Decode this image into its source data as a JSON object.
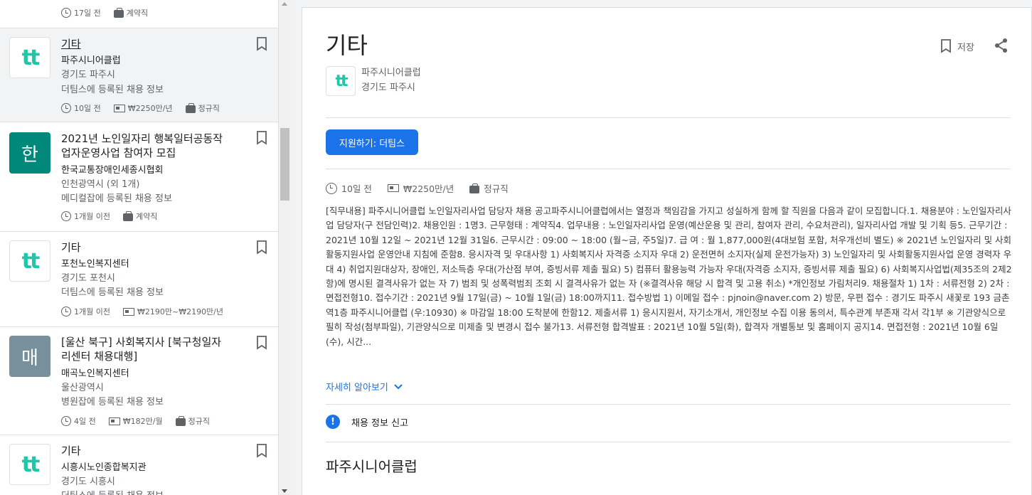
{
  "list": {
    "top_item": {
      "posted": "17일 전",
      "type": "계약직"
    },
    "items": [
      {
        "logo": "tt",
        "title": "기타",
        "company": "파주시니어클럽",
        "location": "경기도 파주시",
        "via": "더팀스에 등록된 채용 정보",
        "posted": "10일 전",
        "salary": "₩2250만/년",
        "type": "정규직"
      },
      {
        "logo": "한",
        "logo_color": "#00897b",
        "title": "2021년 노인일자리 행복일터공동작업자운영사업 참여자 모집",
        "title_line1": "2021년 노인일자리 행복일터공동작",
        "title_line2": "업자운영사업 참여자 모집",
        "company": "한국교통장애인세종시협회",
        "location": "인천광역시 (외 1개)",
        "via": "메디컬잡에 등록된 채용 정보",
        "posted": "1개월 이전",
        "type": "계약직"
      },
      {
        "logo": "tt",
        "title": "기타",
        "company": "포천노인복지센터",
        "location": "경기도 포천시",
        "via": "더팀스에 등록된 채용 정보",
        "posted": "1개월 이전",
        "salary": "₩2190만~₩2190만/년"
      },
      {
        "logo": "매",
        "logo_color": "#78909c",
        "title_line1": "[울산 북구] 사회복지사 [북구청일자",
        "title_line2": "리센터 채용대행]",
        "company": "매곡노인복지센터",
        "location": "울산광역시",
        "via": "병원잡에 등록된 채용 정보",
        "posted": "4일 전",
        "salary": "₩182만/월",
        "type": "정규직"
      },
      {
        "logo": "tt",
        "title": "기타",
        "company": "시흥시노인종합복지관",
        "location": "경기도 시흥시",
        "via": "더팀스에 등록된 채용 정보"
      }
    ]
  },
  "detail": {
    "title": "기타",
    "save_label": "저장",
    "company": "파주시니어클럽",
    "location": "경기도 파주시",
    "apply_label": "지원하기: 더팀스",
    "posted": "10일 전",
    "salary": "₩2250만/년",
    "type": "정규직",
    "description": "[직무내용] 파주시니어클럽 노인일자리사업 담당자 채용 공고파주시니어클럽에서는 열정과 책임감을 가지고 성실하게 함께 할 직원을 다음과 같이 모집합니다.1. 채용분야 : 노인일자리사업 담당자(구 전담인력)2. 채용인원 : 1명3. 근무형태 : 계약직4. 업무내용 : 노인일자리사업 운영(예산운용 및 관리, 참여자 관리, 수요처관리), 일자리사업 개발 및 기획 등5. 근무기간 : 2021년 10월 12일 ~ 2021년 12월 31일6. 근무시간 : 09:00 ~ 18:00 (월~금, 주5일)7. 급 여 : 월 1,877,000원(4대보험 포함, 처우개선비 별도) ※ 2021년 노인일자리 및 사회활동지원사업 운영안내 지침에 준함8. 응시자격 및 우대사항 1) 사회복지사 자격증 소지자 우대 2) 운전면허 소지자(실제 운전가능자) 3) 노인일자리 및 사회활동지원사업 운영 경력자 우대 4) 취업지원대상자, 장애인, 저소득층 우대(가산점 부여, 증빙서류 제출 필요) 5) 컴퓨터 활용능력 가능자 우대(자격증 소지자, 증빙서류 제출 필요) 6) 사회복지사업법(제35조의 2제2항)에 명시된 결격사유가 없는 자 7) 범죄 및 성폭력범죄 조회 시 결격사유가 없는 자 (※결격사유 해당 시 합격 및 고용 취소) *개인정보 가림처리9. 채용절차 1) 1차 : 서류전형 2) 2차 : 면접전형10. 접수기간 : 2021년 9월 17일(금) ~ 10월 1일(금) 18:00까지11. 접수방법 1) 이메일 접수 : pjnoin@naver.com 2) 방문, 우편 접수 : 경기도 파주시 새꽃로 193 금촌역1층 파주시니어클럽 (우:10930) ※ 마감일 18:00 도착분에 한함12. 제출서류 1) 응시지원서, 자기소개서, 개인정보 수집 이용 동의서, 특수관계 부존재 각서 각1부 ※ 기관양식으로 필히 작성(첨부파일), 기관양식으로 미제출 및 변경시 접수 불가13. 서류전형 합격발표 : 2021년 10월 5일(화), 합격자 개별통보 및 홈페이지 공지14. 면접전형 : 2021년 10월 6일(수), 시간...",
    "more_label": "자세히 알아보기",
    "report_label": "채용 정보 신고",
    "company_section_title": "파주시니어클럽"
  },
  "colors": {
    "accent": "#1a73e8",
    "teal": "#1fc7a8"
  }
}
